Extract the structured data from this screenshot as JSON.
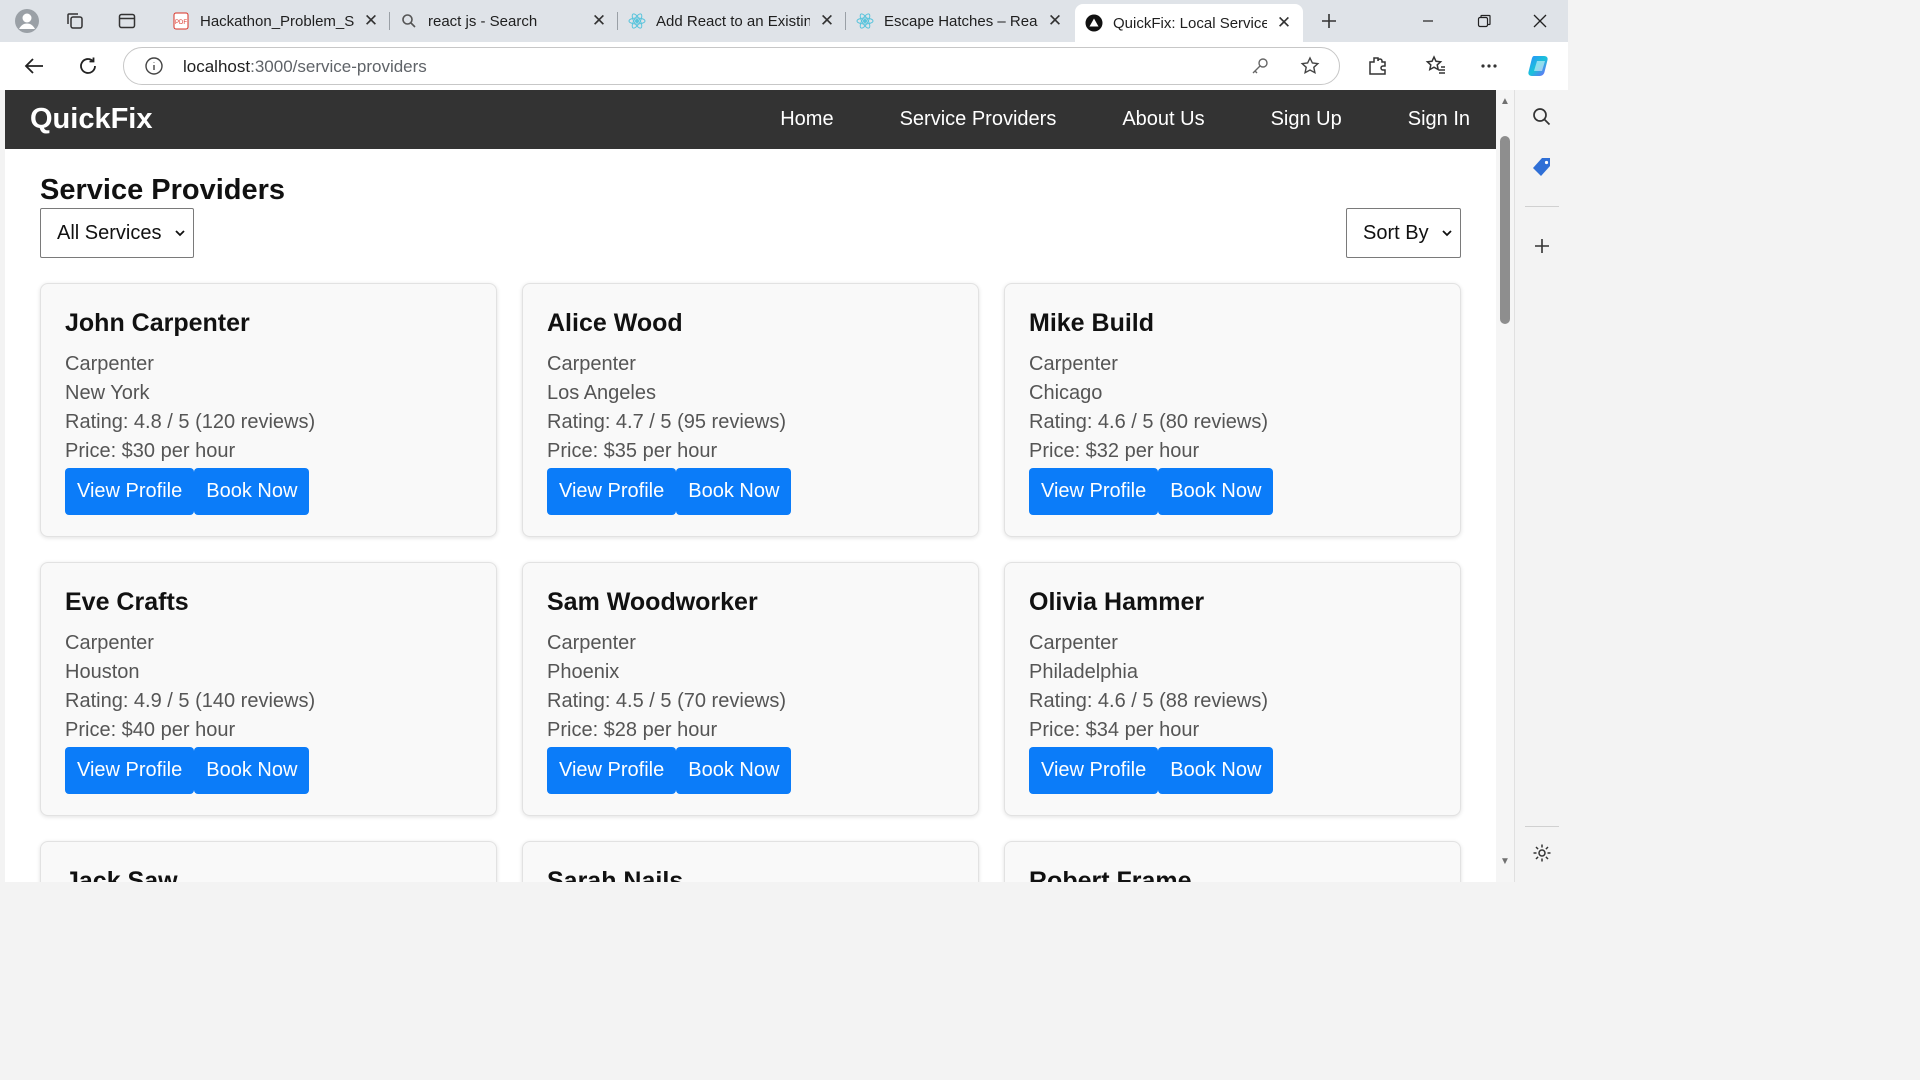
{
  "browser": {
    "tabs": [
      {
        "title": "Hackathon_Problem_Sta",
        "icon": "pdf-icon"
      },
      {
        "title": "react js - Search",
        "icon": "search-icon"
      },
      {
        "title": "Add React to an Existing",
        "icon": "react-icon"
      },
      {
        "title": "Escape Hatches – React",
        "icon": "react-icon"
      },
      {
        "title": "QuickFix: Local Service F",
        "icon": "app-icon"
      }
    ],
    "url_host": "localhost",
    "url_rest": ":3000/service-providers"
  },
  "nav": {
    "brand": "QuickFix",
    "links": [
      "Home",
      "Service Providers",
      "About Us",
      "Sign Up",
      "Sign In"
    ]
  },
  "page": {
    "title": "Service Providers",
    "filter_value": "All Services",
    "sort_value": "Sort By"
  },
  "providers": [
    {
      "name": "John Carpenter",
      "service": "Carpenter",
      "city": "New York",
      "rating": "Rating: 4.8 / 5 (120 reviews)",
      "price": "Price: $30 per hour"
    },
    {
      "name": "Alice Wood",
      "service": "Carpenter",
      "city": "Los Angeles",
      "rating": "Rating: 4.7 / 5 (95 reviews)",
      "price": "Price: $35 per hour"
    },
    {
      "name": "Mike Build",
      "service": "Carpenter",
      "city": "Chicago",
      "rating": "Rating: 4.6 / 5 (80 reviews)",
      "price": "Price: $32 per hour"
    },
    {
      "name": "Eve Crafts",
      "service": "Carpenter",
      "city": "Houston",
      "rating": "Rating: 4.9 / 5 (140 reviews)",
      "price": "Price: $40 per hour"
    },
    {
      "name": "Sam Woodworker",
      "service": "Carpenter",
      "city": "Phoenix",
      "rating": "Rating: 4.5 / 5 (70 reviews)",
      "price": "Price: $28 per hour"
    },
    {
      "name": "Olivia Hammer",
      "service": "Carpenter",
      "city": "Philadelphia",
      "rating": "Rating: 4.6 / 5 (88 reviews)",
      "price": "Price: $34 per hour"
    },
    {
      "name": "Jack Saw",
      "service": "",
      "city": "",
      "rating": "",
      "price": ""
    },
    {
      "name": "Sarah Nails",
      "service": "",
      "city": "",
      "rating": "",
      "price": ""
    },
    {
      "name": "Robert Frame",
      "service": "",
      "city": "",
      "rating": "",
      "price": ""
    }
  ],
  "buttons": {
    "view": "View Profile",
    "book": "Book Now"
  },
  "colors": {
    "navbar": "#333333",
    "button": "#0b7cf9",
    "card_bg": "#f9f9f9"
  }
}
